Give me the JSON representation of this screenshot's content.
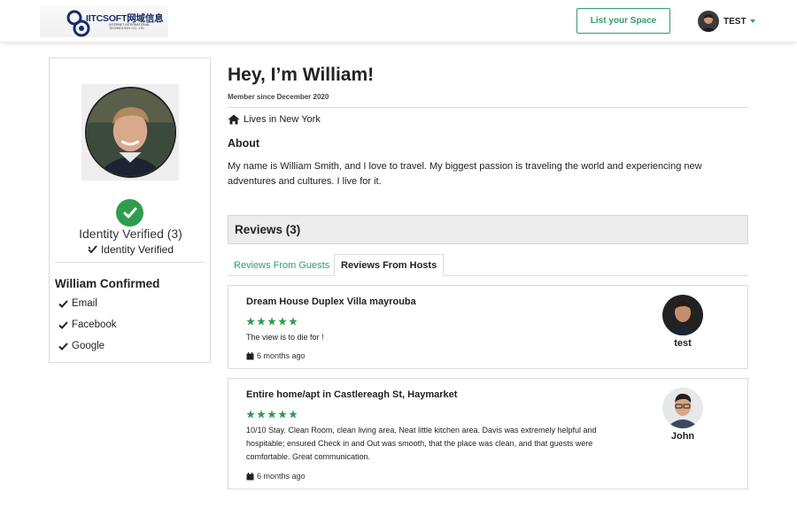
{
  "header": {
    "logo_main": "IITCSOFT网域信息",
    "logo_sub": "INTERNET INTERNATIONAL TECHNOLOGY CO., LTD",
    "list_space_label": "List your Space",
    "user_name": "TEST",
    "accent_color": "#2e9e6b"
  },
  "sidebar": {
    "verified_title": "Identity Verified (3)",
    "verified_sub": "Identity Verified",
    "confirmed_title": "William Confirmed",
    "confirmed_items": [
      {
        "label": "Email",
        "icon": "check-icon"
      },
      {
        "label": "Facebook",
        "icon": "check-icon"
      },
      {
        "label": "Google",
        "icon": "check-icon"
      }
    ]
  },
  "profile": {
    "title": "Hey, I’m William!",
    "member_since": "Member since December 2020",
    "lives_in": "Lives in New York",
    "about_title": "About",
    "about_text": "My name is William Smith, and I love to travel. My biggest passion is traveling the world and experiencing new adventures and cultures. I live for it."
  },
  "reviews": {
    "heading": "Reviews (3)",
    "tabs": [
      {
        "label": "Reviews From Guests",
        "active": false
      },
      {
        "label": "Reviews From Hosts",
        "active": true
      }
    ],
    "items": [
      {
        "title": "Dream House Duplex Villa mayrouba",
        "rating": 5,
        "text": "The view is to die for !",
        "date": "6 months ago",
        "reviewer": "test"
      },
      {
        "title": "Entire home/apt in Castlereagh St, Haymarket",
        "rating": 5,
        "text": "10/10 Stay. Clean Room, clean living area, Neat little kitchen area. Davis was extremely helpful and hospitable; ensured Check in and Out was smooth, that the place was clean, and that guests were comfortable. Great communication.",
        "date": "6 months ago",
        "reviewer": "John"
      }
    ]
  },
  "colors": {
    "star": "#2e9e4e",
    "verified": "#2e9e4e"
  }
}
